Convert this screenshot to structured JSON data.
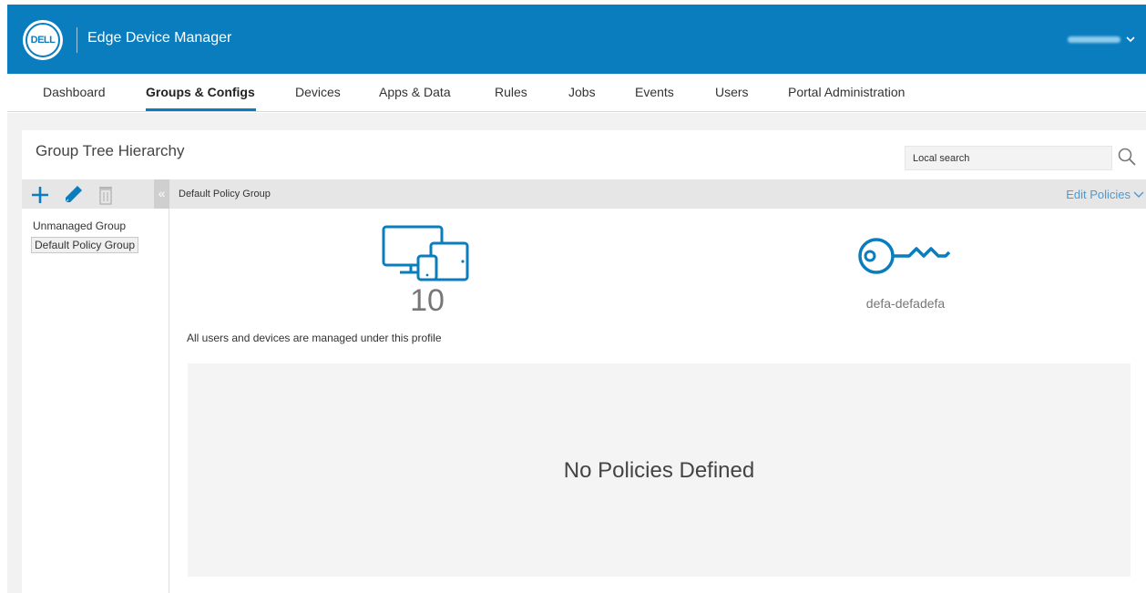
{
  "header": {
    "logo_text": "DELL",
    "app_title": "Edge Device Manager",
    "user_email_redacted": "",
    "colors": {
      "brand_blue": "#0a7dbf",
      "link_blue": "#4a9bd1"
    }
  },
  "nav": {
    "items": [
      {
        "label": "Dashboard",
        "active": false
      },
      {
        "label": "Groups & Configs",
        "active": true
      },
      {
        "label": "Devices",
        "active": false
      },
      {
        "label": "Apps & Data",
        "active": false
      },
      {
        "label": "Rules",
        "active": false
      },
      {
        "label": "Jobs",
        "active": false
      },
      {
        "label": "Events",
        "active": false
      },
      {
        "label": "Users",
        "active": false
      },
      {
        "label": "Portal Administration",
        "active": false
      }
    ]
  },
  "panel": {
    "title": "Group Tree Hierarchy",
    "search_placeholder": "Local search",
    "toolbar_icons": [
      "add-icon",
      "edit-icon",
      "delete-icon"
    ],
    "collapse_glyph": "«"
  },
  "tree": {
    "items": [
      {
        "label": "Unmanaged Group",
        "selected": false
      },
      {
        "label": "Default Policy Group",
        "selected": true
      }
    ]
  },
  "group_detail": {
    "name": "Default Policy Group",
    "edit_policies_label": "Edit Policies",
    "device_count": "10",
    "key_label": "defa-defadefa",
    "profile_note": "All users and devices are managed under this profile",
    "empty_policies_text": "No Policies Defined"
  }
}
